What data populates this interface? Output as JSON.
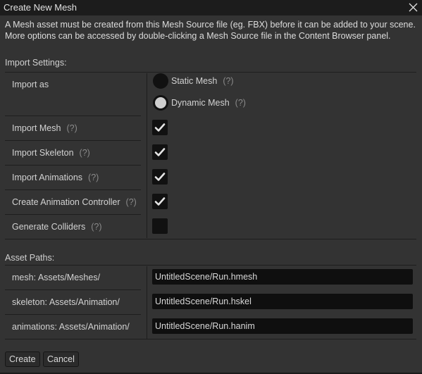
{
  "window": {
    "title": "Create New Mesh",
    "close_icon": "close-icon"
  },
  "description": "A Mesh asset must be created from this Mesh Source file (eg. FBX) before it can be added to your scene. More options can be accessed by double-clicking a Mesh Source file in the Content Browser panel.",
  "import_settings": {
    "heading": "Import Settings:",
    "import_as": {
      "label": "Import as",
      "options": [
        {
          "label": "Static Mesh",
          "help": "(?)",
          "selected": false
        },
        {
          "label": "Dynamic Mesh",
          "help": "(?)",
          "selected": true
        }
      ]
    },
    "options": [
      {
        "label": "Import Mesh",
        "help": "(?)",
        "checked": true
      },
      {
        "label": "Import Skeleton",
        "help": "(?)",
        "checked": true
      },
      {
        "label": "Import Animations",
        "help": "(?)",
        "checked": true
      },
      {
        "label": "Create Animation Controller",
        "help": "(?)",
        "checked": true
      },
      {
        "label": "Generate Colliders",
        "help": "(?)",
        "checked": false
      }
    ]
  },
  "asset_paths": {
    "heading": "Asset Paths:",
    "rows": [
      {
        "label": "mesh: Assets/Meshes/",
        "value": "UntitledScene/Run.hmesh"
      },
      {
        "label": "skeleton: Assets/Animation/",
        "value": "UntitledScene/Run.hskel"
      },
      {
        "label": "animations: Assets/Animation/",
        "value": "UntitledScene/Run.hanim"
      }
    ]
  },
  "buttons": {
    "create": "Create",
    "cancel": "Cancel"
  }
}
